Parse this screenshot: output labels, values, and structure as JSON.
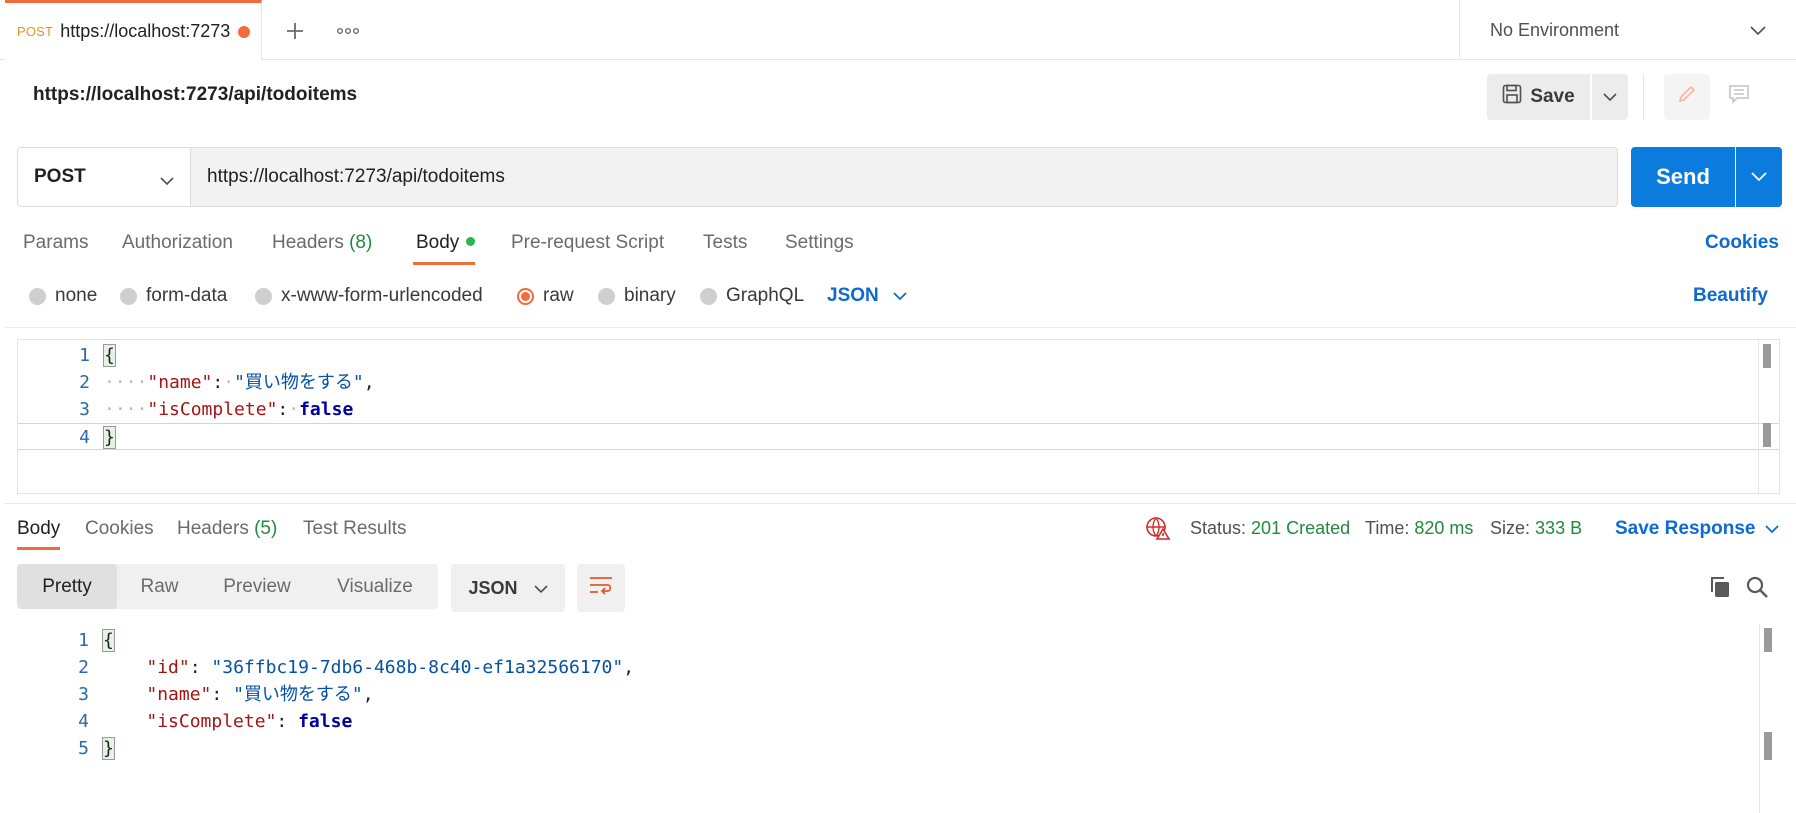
{
  "tab": {
    "method": "POST",
    "url": "https://localhost:7273",
    "add_icon": "plus-icon",
    "more_icon": "ellipsis-icon"
  },
  "environment": {
    "label": "No Environment"
  },
  "request": {
    "name": "https://localhost:7273/api/todoitems",
    "save_label": "Save",
    "method": "POST",
    "url": "https://localhost:7273/api/todoitems",
    "send_label": "Send"
  },
  "request_tabs": {
    "params": "Params",
    "authorization": "Authorization",
    "headers": "Headers",
    "headers_count": "(8)",
    "body": "Body",
    "prerequest": "Pre-request Script",
    "tests": "Tests",
    "settings": "Settings",
    "cookies": "Cookies"
  },
  "body_types": {
    "none": "none",
    "form_data": "form-data",
    "urlencoded": "x-www-form-urlencoded",
    "raw": "raw",
    "binary": "binary",
    "graphql": "GraphQL",
    "selected": "raw",
    "language": "JSON",
    "beautify": "Beautify"
  },
  "request_body_lines": [
    "1",
    "2",
    "3",
    "4"
  ],
  "request_body": {
    "open": "{",
    "name_key": "\"name\"",
    "name_val": "\"買い物をする\"",
    "complete_key": "\"isComplete\"",
    "complete_val": "false",
    "close": "}"
  },
  "response_tabs": {
    "body": "Body",
    "cookies": "Cookies",
    "headers": "Headers",
    "headers_count": "(5)",
    "test_results": "Test Results"
  },
  "response_status": {
    "status_label": "Status:",
    "status_value": "201 Created",
    "time_label": "Time:",
    "time_value": "820 ms",
    "size_label": "Size:",
    "size_value": "333 B",
    "save_response": "Save Response"
  },
  "response_view": {
    "pretty": "Pretty",
    "raw": "Raw",
    "preview": "Preview",
    "visualize": "Visualize",
    "language": "JSON"
  },
  "response_body_lines": [
    "1",
    "2",
    "3",
    "4",
    "5"
  ],
  "response_body": {
    "open": "{",
    "id_key": "\"id\"",
    "id_val": "\"36ffbc19-7db6-468b-8c40-ef1a32566170\"",
    "name_key": "\"name\"",
    "name_val": "\"買い物をする\"",
    "complete_key": "\"isComplete\"",
    "complete_val": "false",
    "close": "}"
  },
  "colors": {
    "accent": "#f26b3a",
    "primary": "#0c7bde",
    "link": "#0c6ad1",
    "success": "#218a3c"
  }
}
